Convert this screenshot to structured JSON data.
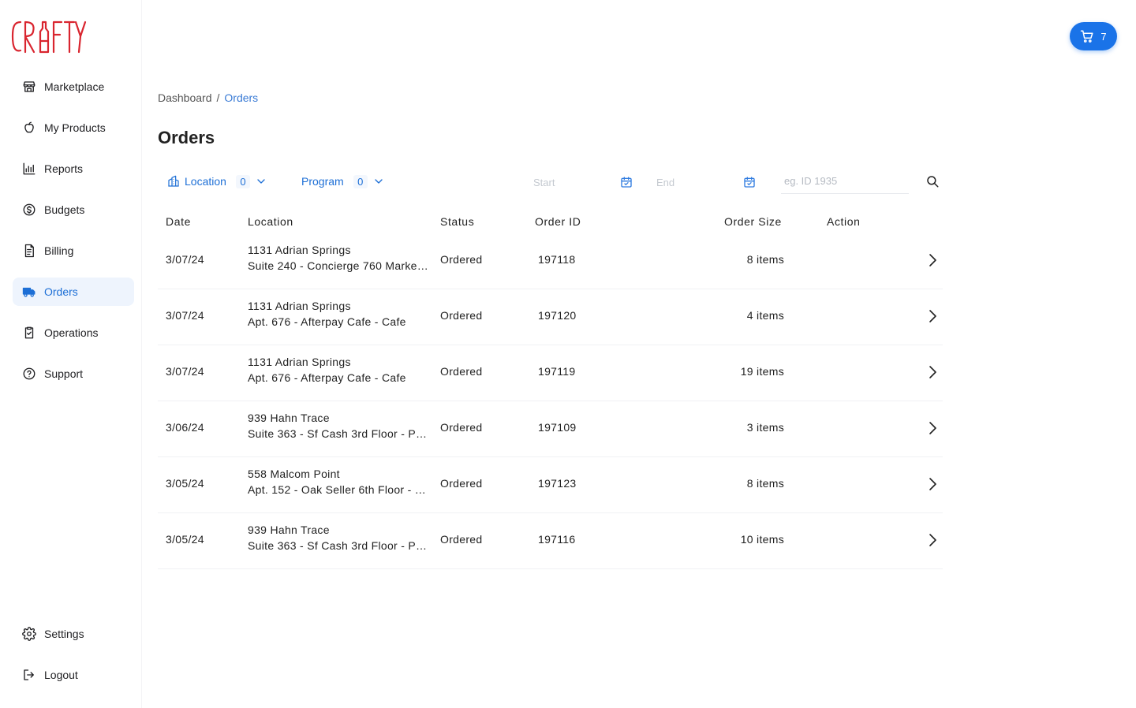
{
  "brand": {
    "logo_text": "CRAFTY",
    "logo_color": "#d9252f"
  },
  "sidebar": {
    "items": [
      {
        "label": "Marketplace",
        "icon": "store-icon",
        "active": false
      },
      {
        "label": "My Products",
        "icon": "apple-icon",
        "active": false
      },
      {
        "label": "Reports",
        "icon": "bar-chart-icon",
        "active": false
      },
      {
        "label": "Budgets",
        "icon": "dollar-coin-icon",
        "active": false
      },
      {
        "label": "Billing",
        "icon": "invoice-icon",
        "active": false
      },
      {
        "label": "Orders",
        "icon": "truck-icon",
        "active": true
      },
      {
        "label": "Operations",
        "icon": "clipboard-check-icon",
        "active": false
      },
      {
        "label": "Support",
        "icon": "help-circle-icon",
        "active": false
      }
    ],
    "bottom_items": [
      {
        "label": "Settings",
        "icon": "gear-icon"
      },
      {
        "label": "Logout",
        "icon": "logout-icon"
      }
    ]
  },
  "header": {
    "cart_count": "7",
    "accent_color": "#1a73e8"
  },
  "breadcrumb": {
    "root": "Dashboard",
    "separator": "/",
    "current": "Orders"
  },
  "page": {
    "title": "Orders"
  },
  "filters": {
    "location": {
      "label": "Location",
      "count": "0"
    },
    "program": {
      "label": "Program",
      "count": "0"
    },
    "start_date": {
      "placeholder": "Start"
    },
    "end_date": {
      "placeholder": "End"
    },
    "search": {
      "placeholder": "eg. ID 1935"
    }
  },
  "table": {
    "columns": [
      "Date",
      "Location",
      "Status",
      "Order ID",
      "Order Size",
      "Action"
    ],
    "rows": [
      {
        "date": "3/07/24",
        "location_line1": "1131 Adrian Springs",
        "location_line2": "Suite 240 - Concierge 760 Marke…",
        "status": "Ordered",
        "order_id": "197118",
        "size": "8 items"
      },
      {
        "date": "3/07/24",
        "location_line1": "1131 Adrian Springs",
        "location_line2": "Apt. 676 - Afterpay Cafe - Cafe",
        "status": "Ordered",
        "order_id": "197120",
        "size": "4 items"
      },
      {
        "date": "3/07/24",
        "location_line1": "1131 Adrian Springs",
        "location_line2": "Apt. 676 - Afterpay Cafe - Cafe",
        "status": "Ordered",
        "order_id": "197119",
        "size": "19 items"
      },
      {
        "date": "3/06/24",
        "location_line1": "939 Hahn Trace",
        "location_line2": "Suite 363 - Sf Cash 3rd Floor - P…",
        "status": "Ordered",
        "order_id": "197109",
        "size": "3 items"
      },
      {
        "date": "3/05/24",
        "location_line1": "558 Malcom Point",
        "location_line2": "Apt. 152 - Oak Seller 6th Floor - …",
        "status": "Ordered",
        "order_id": "197123",
        "size": "8 items"
      },
      {
        "date": "3/05/24",
        "location_line1": "939 Hahn Trace",
        "location_line2": "Suite 363 - Sf Cash 3rd Floor - P…",
        "status": "Ordered",
        "order_id": "197116",
        "size": "10 items"
      }
    ]
  }
}
